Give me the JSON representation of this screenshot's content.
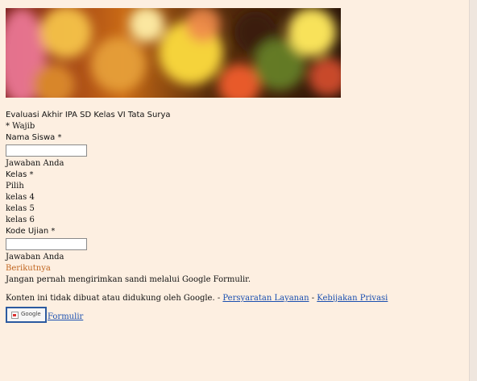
{
  "form": {
    "title": "Evaluasi Akhir IPA SD Kelas VI Tata Surya",
    "required_note": "* Wajib",
    "fields": {
      "nama": {
        "label": "Nama Siswa *",
        "answer_hint": "Jawaban Anda"
      },
      "kelas": {
        "label": "Kelas *",
        "options": [
          "Pilih",
          "kelas 4",
          "kelas 5",
          "kelas 6"
        ]
      },
      "kode": {
        "label": "Kode Ujian *",
        "answer_hint": "Jawaban Anda"
      }
    },
    "next_label": "Berikutnya",
    "password_warning": "Jangan pernah mengirimkan sandi melalui Google Formulir."
  },
  "footer": {
    "disclaimer": "Konten ini tidak dibuat atau didukung oleh Google. -",
    "terms_label": "Persyaratan Layanan",
    "separator": "-",
    "privacy_label": "Kebijakan Privasi",
    "logo_alt": "Google",
    "forms_label": "Formulir"
  },
  "colors": {
    "background": "#fdefe1",
    "link": "#1a4fb0",
    "next": "#c0651f"
  }
}
